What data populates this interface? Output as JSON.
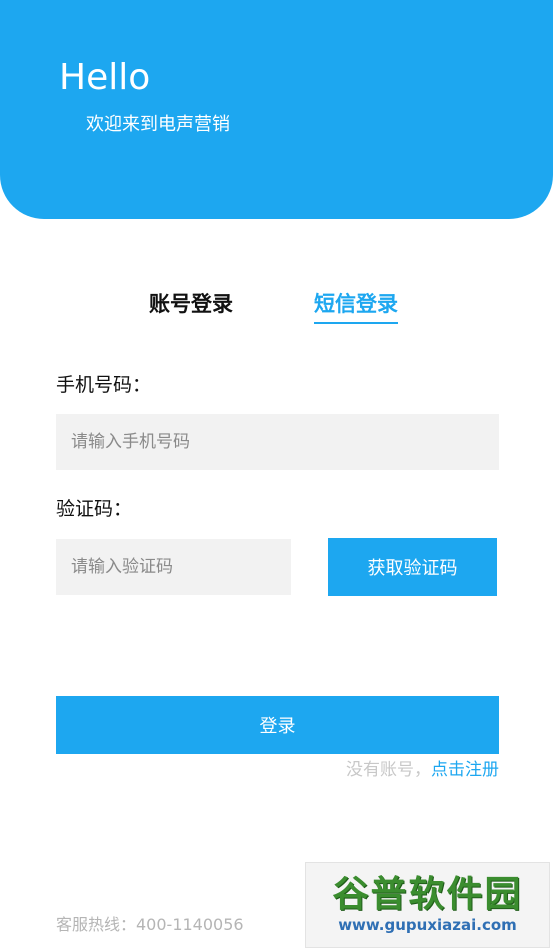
{
  "header": {
    "title": "Hello",
    "subtitle": "欢迎来到电声营销"
  },
  "tabs": [
    {
      "label": "账号登录",
      "active": false
    },
    {
      "label": "短信登录",
      "active": true
    }
  ],
  "form": {
    "phone_label": "手机号码：",
    "phone_placeholder": "请输入手机号码",
    "code_label": "验证码：",
    "code_placeholder": "请输入验证码",
    "get_code_label": "获取验证码",
    "login_label": "登录"
  },
  "register": {
    "prompt": "没有账号，",
    "link": "点击注册"
  },
  "footer": {
    "hotline": "客服热线：400-1140056"
  },
  "watermark": {
    "title": "谷普软件园",
    "url": "www.gupuxiazai.com"
  },
  "colors": {
    "accent": "#1da7f0",
    "input_bg": "#f2f2f2"
  }
}
